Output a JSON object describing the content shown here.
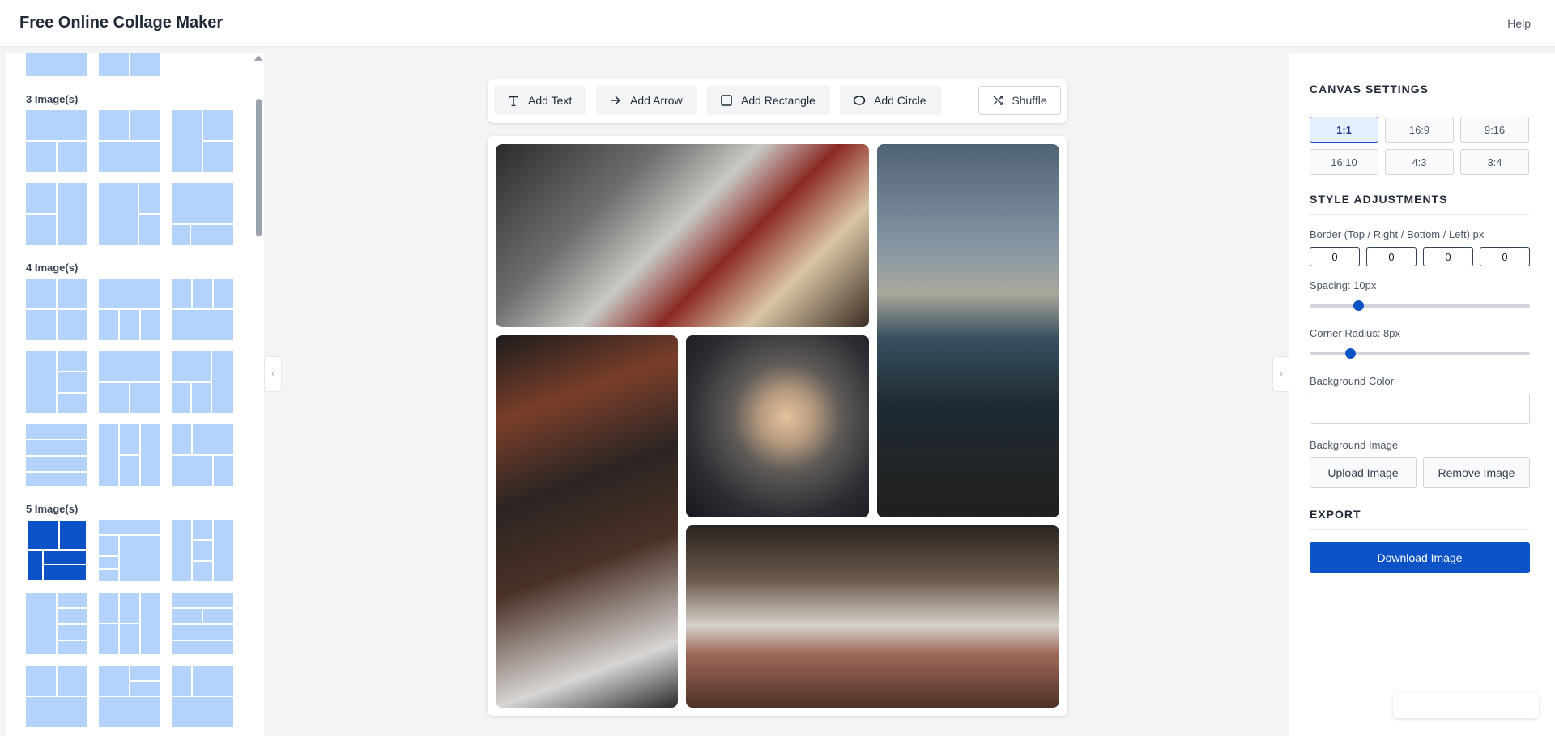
{
  "header": {
    "title": "Free Online Collage Maker",
    "help_label": "Help"
  },
  "sidebar": {
    "groups": [
      {
        "label": "3 Image(s)"
      },
      {
        "label": "4 Image(s)"
      },
      {
        "label": "5 Image(s)"
      }
    ]
  },
  "toolbar": {
    "add_text": "Add Text",
    "add_arrow": "Add Arrow",
    "add_rectangle": "Add Rectangle",
    "add_circle": "Add Circle",
    "shuffle": "Shuffle"
  },
  "canvas_settings": {
    "title": "CANVAS SETTINGS",
    "ratios": [
      "1:1",
      "16:9",
      "9:16",
      "16:10",
      "4:3",
      "3:4"
    ],
    "active_ratio": "1:1"
  },
  "style": {
    "title": "STYLE ADJUSTMENTS",
    "border_label": "Border (Top / Right / Bottom / Left) px",
    "border_values": [
      "0",
      "0",
      "0",
      "0"
    ],
    "spacing_label": "Spacing: 10px",
    "spacing_value": 10,
    "corner_label": "Corner Radius: 8px",
    "corner_value": 8,
    "bg_color_label": "Background Color",
    "bg_image_label": "Background Image",
    "upload_label": "Upload Image",
    "remove_label": "Remove Image"
  },
  "export": {
    "title": "EXPORT",
    "download_label": "Download Image"
  },
  "colors": {
    "accent": "#0b52c7",
    "thumb": "#b3d3fd"
  },
  "icons": [
    "text-icon",
    "arrow-right-icon",
    "square-icon",
    "ellipse-icon",
    "shuffle-icon",
    "chevron-left-icon",
    "chevron-right-icon"
  ]
}
